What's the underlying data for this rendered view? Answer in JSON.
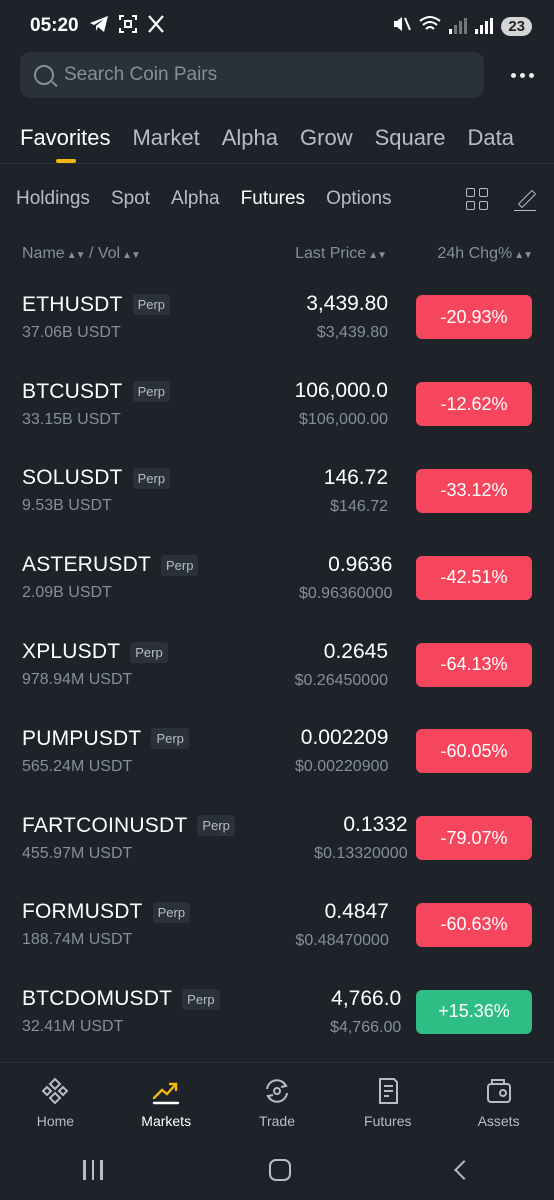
{
  "status_bar": {
    "time": "05:20",
    "battery": "23"
  },
  "search": {
    "placeholder": "Search Coin Pairs"
  },
  "main_tabs": [
    "Favorites",
    "Market",
    "Alpha",
    "Grow",
    "Square",
    "Data"
  ],
  "main_tab_active": "Favorites",
  "sub_tabs": [
    "Holdings",
    "Spot",
    "Alpha",
    "Futures",
    "Options"
  ],
  "sub_tab_active": "Futures",
  "columns": {
    "name": "Name",
    "vol": "/ Vol",
    "price": "Last Price",
    "change": "24h Chg%"
  },
  "rows": [
    {
      "symbol": "ETHUSDT",
      "tag": "Perp",
      "vol": "37.06B USDT",
      "price": "3,439.80",
      "fiat": "$3,439.80",
      "change": "-20.93%",
      "dir": "down"
    },
    {
      "symbol": "BTCUSDT",
      "tag": "Perp",
      "vol": "33.15B USDT",
      "price": "106,000.0",
      "fiat": "$106,000.00",
      "change": "-12.62%",
      "dir": "down"
    },
    {
      "symbol": "SOLUSDT",
      "tag": "Perp",
      "vol": "9.53B USDT",
      "price": "146.72",
      "fiat": "$146.72",
      "change": "-33.12%",
      "dir": "down"
    },
    {
      "symbol": "ASTERUSDT",
      "tag": "Perp",
      "vol": "2.09B USDT",
      "price": "0.9636",
      "fiat": "$0.96360000",
      "change": "-42.51%",
      "dir": "down"
    },
    {
      "symbol": "XPLUSDT",
      "tag": "Perp",
      "vol": "978.94M USDT",
      "price": "0.2645",
      "fiat": "$0.26450000",
      "change": "-64.13%",
      "dir": "down"
    },
    {
      "symbol": "PUMPUSDT",
      "tag": "Perp",
      "vol": "565.24M USDT",
      "price": "0.002209",
      "fiat": "$0.00220900",
      "change": "-60.05%",
      "dir": "down"
    },
    {
      "symbol": "FARTCOINUSDT",
      "tag": "Perp",
      "vol": "455.97M USDT",
      "price": "0.1332",
      "fiat": "$0.13320000",
      "change": "-79.07%",
      "dir": "down"
    },
    {
      "symbol": "FORMUSDT",
      "tag": "Perp",
      "vol": "188.74M USDT",
      "price": "0.4847",
      "fiat": "$0.48470000",
      "change": "-60.63%",
      "dir": "down"
    },
    {
      "symbol": "BTCDOMUSDT",
      "tag": "Perp",
      "vol": "32.41M USDT",
      "price": "4,766.0",
      "fiat": "$4,766.00",
      "change": "+15.36%",
      "dir": "up"
    }
  ],
  "bottom_nav": [
    {
      "label": "Home",
      "icon": "binance-logo-icon"
    },
    {
      "label": "Markets",
      "icon": "markets-chart-icon"
    },
    {
      "label": "Trade",
      "icon": "trade-swap-icon"
    },
    {
      "label": "Futures",
      "icon": "futures-doc-icon"
    },
    {
      "label": "Assets",
      "icon": "wallet-icon"
    }
  ],
  "bottom_nav_active": "Markets",
  "colors": {
    "background": "#1e2329",
    "accent": "#f0b90b",
    "down": "#f6465d",
    "up": "#2ebd85"
  }
}
